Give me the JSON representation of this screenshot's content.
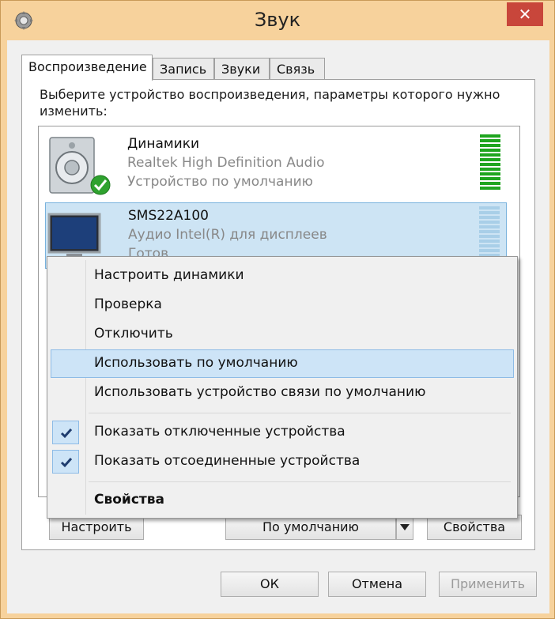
{
  "window": {
    "title": "Звук",
    "close_glyph": "✕"
  },
  "tabs": [
    {
      "label": "Воспроизведение",
      "active": true
    },
    {
      "label": "Запись",
      "active": false
    },
    {
      "label": "Звуки",
      "active": false
    },
    {
      "label": "Связь",
      "active": false
    }
  ],
  "instruction": "Выберите устройство воспроизведения, параметры которого нужно изменить:",
  "devices": [
    {
      "name": "Динамики",
      "driver": "Realtek High Definition Audio",
      "status": "Устройство по умолчанию",
      "icon": "speaker-icon",
      "is_default": true,
      "level": 1.0
    },
    {
      "name": "SMS22A100",
      "driver": "Аудио Intel(R) для дисплеев",
      "status": "Готов",
      "icon": "monitor-icon",
      "is_default": false,
      "level": 0.0
    }
  ],
  "context_menu": {
    "items": [
      {
        "label": "Настроить динамики",
        "checked": false,
        "highlighted": false,
        "bold": false
      },
      {
        "label": "Проверка",
        "checked": false,
        "highlighted": false,
        "bold": false
      },
      {
        "label": "Отключить",
        "checked": false,
        "highlighted": false,
        "bold": false
      },
      {
        "label": "Использовать по умолчанию",
        "checked": false,
        "highlighted": true,
        "bold": false
      },
      {
        "label": "Использовать устройство связи по умолчанию",
        "checked": false,
        "highlighted": false,
        "bold": false
      },
      {
        "label": "Показать отключенные устройства",
        "checked": true,
        "highlighted": false,
        "bold": false
      },
      {
        "label": "Показать отсоединенные устройства",
        "checked": true,
        "highlighted": false,
        "bold": false
      },
      {
        "label": "Свойства",
        "checked": false,
        "highlighted": false,
        "bold": true
      }
    ]
  },
  "panel_buttons": {
    "configure": "Настроить",
    "set_default": "По умолчанию",
    "properties": "Свойства"
  },
  "dialog_buttons": {
    "ok": "ОК",
    "cancel": "Отмена",
    "apply": "Применить"
  },
  "colors": {
    "level_active": "#1fa51f",
    "level_inactive": "#a9cfe8",
    "check": "#1f3c6e",
    "default_badge": "#2fa22f"
  }
}
